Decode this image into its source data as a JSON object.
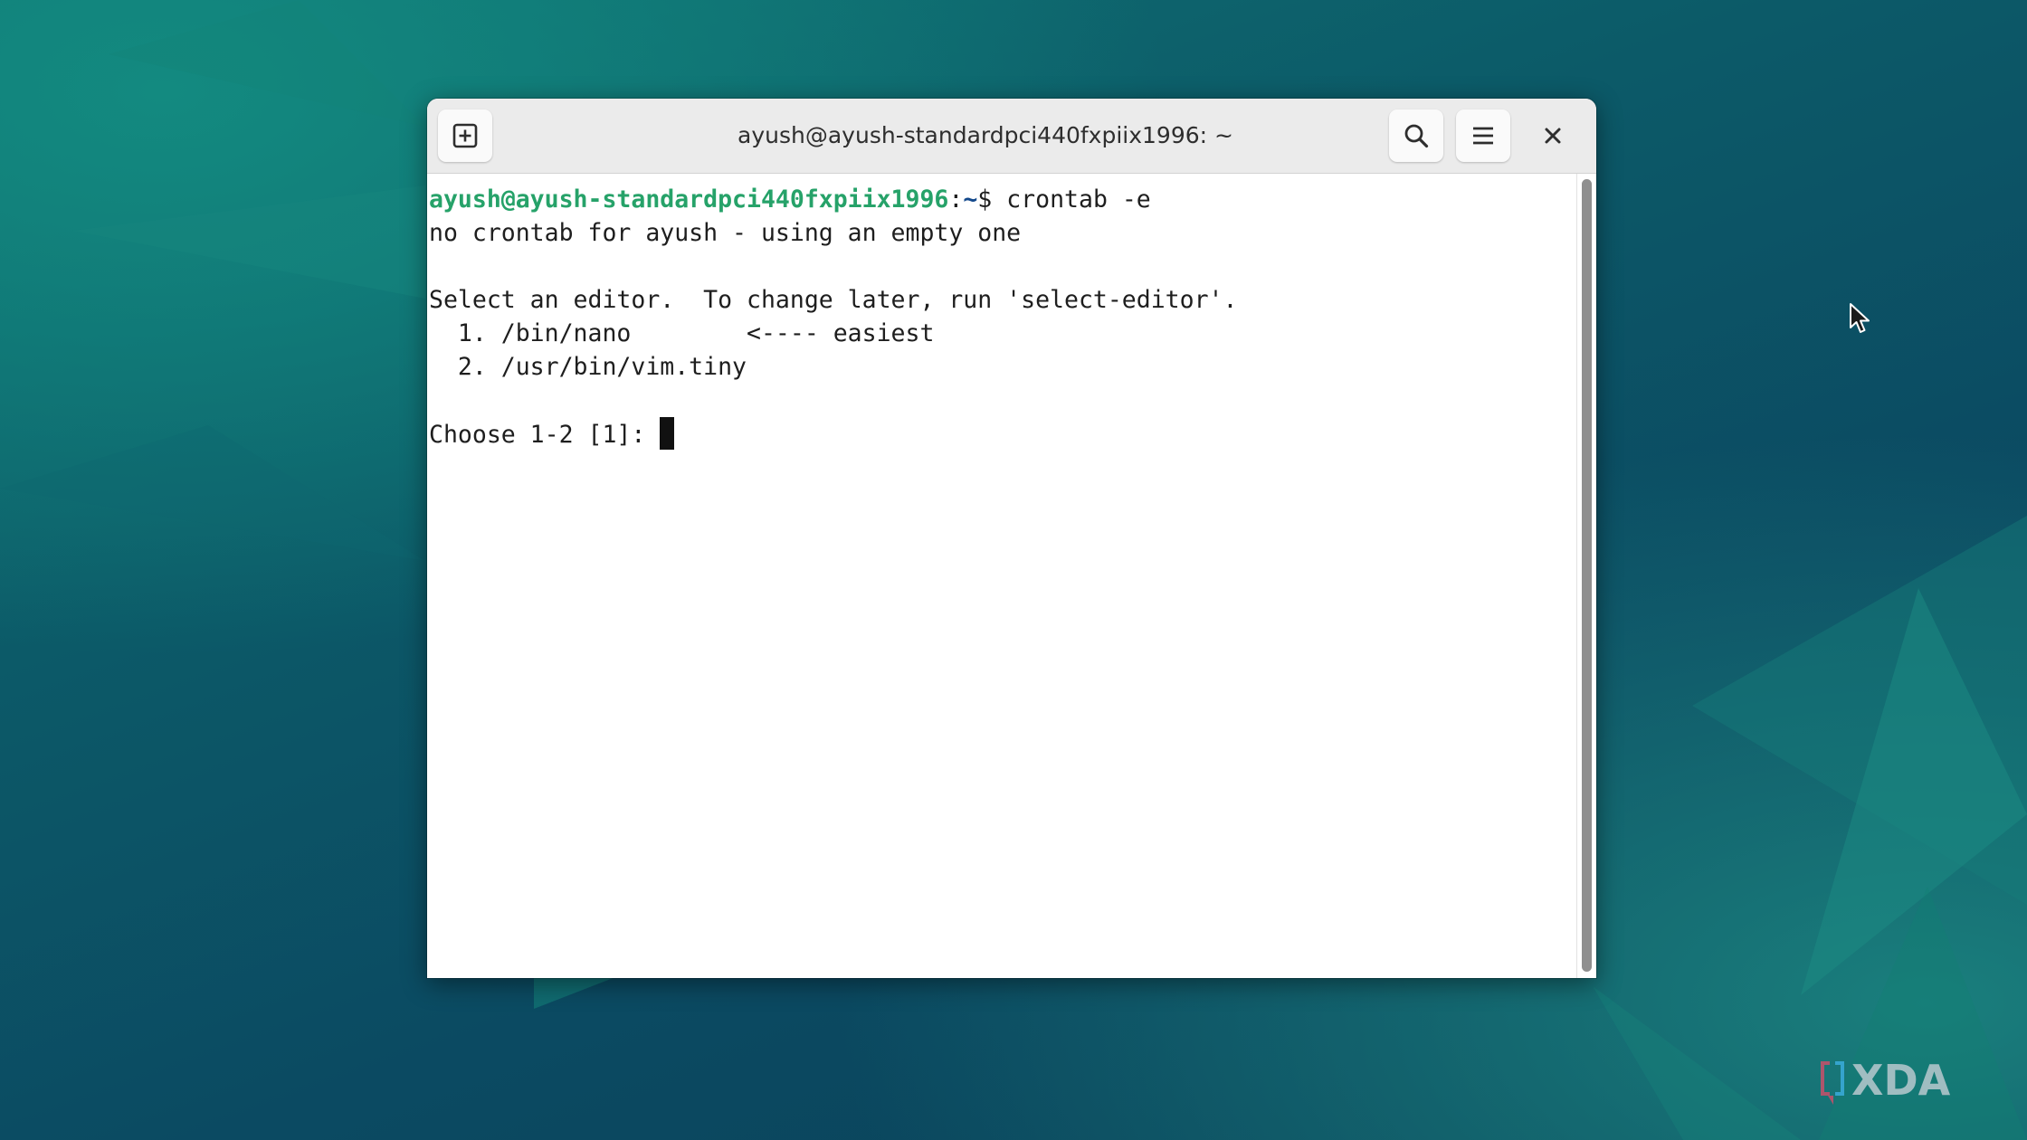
{
  "window": {
    "title": "ayush@ayush-standardpci440fxpiix1996: ~"
  },
  "terminal": {
    "prompt_user_host": "ayush@ayush-standardpci440fxpiix1996",
    "prompt_sep": ":",
    "prompt_path": "~",
    "prompt_symbol": "$ ",
    "command": "crontab -e",
    "output_lines": [
      "no crontab for ayush - using an empty one",
      "",
      "Select an editor.  To change later, run 'select-editor'.",
      "  1. /bin/nano        <---- easiest",
      "  2. /usr/bin/vim.tiny",
      ""
    ],
    "input_prompt": "Choose 1-2 [1]: "
  },
  "watermark": {
    "text": "XDA"
  },
  "colors": {
    "prompt_user": "#26a269",
    "prompt_path": "#12488b",
    "terminal_text": "#1e1e1e",
    "titlebar_bg": "#ebebeb",
    "desktop_bg": "#0b4d63"
  },
  "icons": {
    "new_tab": "new-tab-icon",
    "search": "search-icon",
    "menu": "hamburger-menu-icon",
    "close": "close-icon",
    "pointer": "mouse-pointer-icon"
  }
}
